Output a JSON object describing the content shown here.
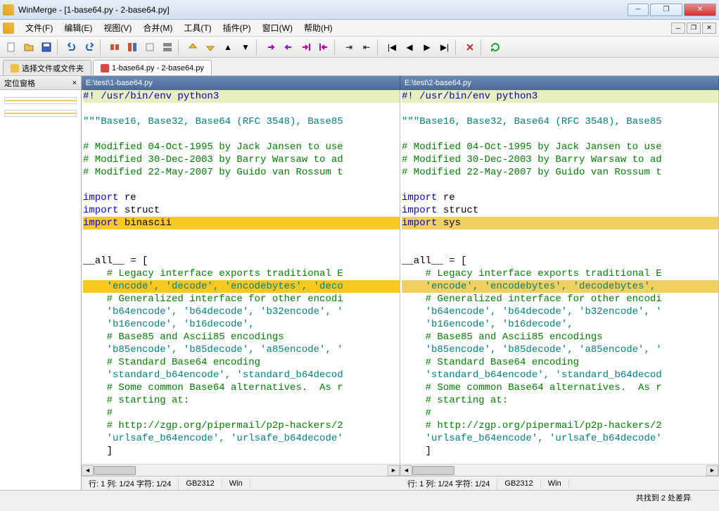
{
  "title": "WinMerge - [1-base64.py - 2-base64.py]",
  "menus": [
    "文件(F)",
    "编辑(E)",
    "视图(V)",
    "合并(M)",
    "工具(T)",
    "插件(P)",
    "窗口(W)",
    "帮助(H)"
  ],
  "tabs": [
    {
      "label": "选择文件或文件夹",
      "kind": "folder"
    },
    {
      "label": "1-base64.py - 2-base64.py",
      "kind": "py"
    }
  ],
  "locpane_title": "定位窗格",
  "left": {
    "path": "E:\\test\\1-base64.py",
    "lines": [
      {
        "t": "#! /usr/bin/env python3",
        "c": "shebang"
      },
      {
        "t": "",
        "c": ""
      },
      {
        "t": "\"\"\"Base16, Base32, Base64 (RFC 3548), Base85",
        "c": "str"
      },
      {
        "t": "",
        "c": ""
      },
      {
        "t": "# Modified 04-Oct-1995 by Jack Jansen to use",
        "c": "cmt"
      },
      {
        "t": "# Modified 30-Dec-2003 by Barry Warsaw to ad",
        "c": "cmt"
      },
      {
        "t": "# Modified 22-May-2007 by Guido van Rossum t",
        "c": "cmt"
      },
      {
        "t": "",
        "c": ""
      },
      {
        "t": "import re",
        "c": "kw",
        "plain": " re"
      },
      {
        "t": "import struct",
        "c": "kw",
        "plain": " struct"
      },
      {
        "t": "import binascii",
        "c": "kw hlsel",
        "plain": " binascii"
      },
      {
        "t": "",
        "c": ""
      },
      {
        "t": "",
        "c": ""
      },
      {
        "t": "__all__ = [",
        "c": ""
      },
      {
        "t": "    # Legacy interface exports traditional E",
        "c": "cmt"
      },
      {
        "t": "    'encode', 'decode', 'encodebytes', 'deco",
        "c": "str hlsel"
      },
      {
        "t": "    # Generalized interface for other encodi",
        "c": "cmt"
      },
      {
        "t": "    'b64encode', 'b64decode', 'b32encode', '",
        "c": "str"
      },
      {
        "t": "    'b16encode', 'b16decode',",
        "c": "str"
      },
      {
        "t": "    # Base85 and Ascii85 encodings",
        "c": "cmt"
      },
      {
        "t": "    'b85encode', 'b85decode', 'a85encode', '",
        "c": "str"
      },
      {
        "t": "    # Standard Base64 encoding",
        "c": "cmt"
      },
      {
        "t": "    'standard_b64encode', 'standard_b64decod",
        "c": "str"
      },
      {
        "t": "    # Some common Base64 alternatives.  As r",
        "c": "cmt"
      },
      {
        "t": "    # starting at:",
        "c": "cmt"
      },
      {
        "t": "    #",
        "c": "cmt"
      },
      {
        "t": "    # http://zgp.org/pipermail/p2p-hackers/2",
        "c": "cmt"
      },
      {
        "t": "    'urlsafe_b64encode', 'urlsafe_b64decode'",
        "c": "str"
      },
      {
        "t": "    ]",
        "c": ""
      }
    ],
    "status": {
      "pos": "行: 1 列: 1/24 字符: 1/24",
      "enc": "GB2312",
      "os": "Win"
    }
  },
  "right": {
    "path": "E:\\test\\2-base64.py",
    "lines": [
      {
        "t": "#! /usr/bin/env python3",
        "c": "shebang"
      },
      {
        "t": "",
        "c": ""
      },
      {
        "t": "\"\"\"Base16, Base32, Base64 (RFC 3548), Base85",
        "c": "str"
      },
      {
        "t": "",
        "c": ""
      },
      {
        "t": "# Modified 04-Oct-1995 by Jack Jansen to use",
        "c": "cmt"
      },
      {
        "t": "# Modified 30-Dec-2003 by Barry Warsaw to ad",
        "c": "cmt"
      },
      {
        "t": "# Modified 22-May-2007 by Guido van Rossum t",
        "c": "cmt"
      },
      {
        "t": "",
        "c": ""
      },
      {
        "t": "import re",
        "c": "kw",
        "plain": " re"
      },
      {
        "t": "import struct",
        "c": "kw",
        "plain": " struct"
      },
      {
        "t": "import sys",
        "c": "kw hl",
        "plain": " sys"
      },
      {
        "t": "",
        "c": ""
      },
      {
        "t": "",
        "c": ""
      },
      {
        "t": "__all__ = [",
        "c": ""
      },
      {
        "t": "    # Legacy interface exports traditional E",
        "c": "cmt"
      },
      {
        "t": "    'encode', 'encodebytes', 'decodebytes',",
        "c": "str hl"
      },
      {
        "t": "    # Generalized interface for other encodi",
        "c": "cmt"
      },
      {
        "t": "    'b64encode', 'b64decode', 'b32encode', '",
        "c": "str"
      },
      {
        "t": "    'b16encode', 'b16decode',",
        "c": "str"
      },
      {
        "t": "    # Base85 and Ascii85 encodings",
        "c": "cmt"
      },
      {
        "t": "    'b85encode', 'b85decode', 'a85encode', '",
        "c": "str"
      },
      {
        "t": "    # Standard Base64 encoding",
        "c": "cmt"
      },
      {
        "t": "    'standard_b64encode', 'standard_b64decod",
        "c": "str"
      },
      {
        "t": "    # Some common Base64 alternatives.  As r",
        "c": "cmt"
      },
      {
        "t": "    # starting at:",
        "c": "cmt"
      },
      {
        "t": "    #",
        "c": "cmt"
      },
      {
        "t": "    # http://zgp.org/pipermail/p2p-hackers/2",
        "c": "cmt"
      },
      {
        "t": "    'urlsafe_b64encode', 'urlsafe_b64decode'",
        "c": "str"
      },
      {
        "t": "    ]",
        "c": ""
      }
    ],
    "status": {
      "pos": "行: 1 列: 1/24 字符: 1/24",
      "enc": "GB2312",
      "os": "Win"
    }
  },
  "statusbar": "共找到 2 处差异"
}
